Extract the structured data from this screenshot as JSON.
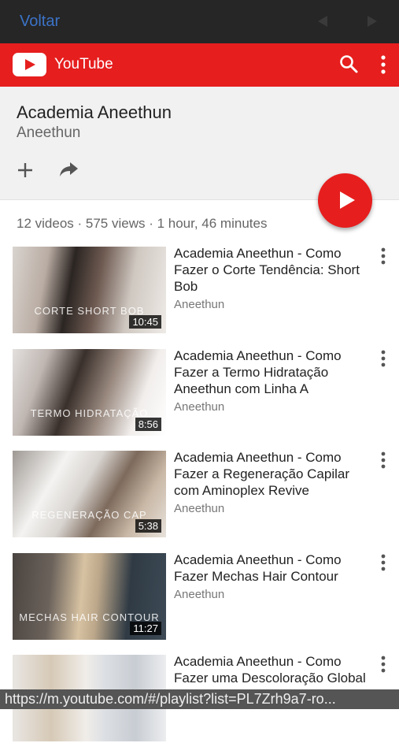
{
  "browser": {
    "back_label": "Voltar"
  },
  "app": {
    "name": "YouTube",
    "brand_color": "#e61e1e"
  },
  "playlist": {
    "title": "Academia Aneethun",
    "owner": "Aneethun",
    "stats": "12 videos · 575 views · 1 hour, 46 minutes"
  },
  "videos": [
    {
      "title": "Academia Aneethun - Como Fazer o Corte Tendência: Short Bob",
      "channel": "Aneethun",
      "duration": "10:45",
      "thumb_caption": "CORTE SHORT BOB"
    },
    {
      "title": "Academia Aneethun - Como Fazer a Termo Hidratação Aneethun com Linha A",
      "channel": "Aneethun",
      "duration": "8:56",
      "thumb_caption": "TERMO HIDRATAÇÃO"
    },
    {
      "title": "Academia Aneethun - Como Fazer a Regeneração Capilar com Aminoplex Revive",
      "channel": "Aneethun",
      "duration": "5:38",
      "thumb_caption": "REGENERAÇÃO CAP"
    },
    {
      "title": "Academia Aneethun - Como Fazer Mechas Hair Contour",
      "channel": "Aneethun",
      "duration": "11:27",
      "thumb_caption": "MECHAS HAIR CONTOUR"
    },
    {
      "title": "Academia Aneethun - Como Fazer uma Descoloração Global",
      "channel": "",
      "duration": "",
      "thumb_caption": ""
    }
  ],
  "status_url": "https://m.youtube.com/#/playlist?list=PL7Zrh9a7-ro..."
}
